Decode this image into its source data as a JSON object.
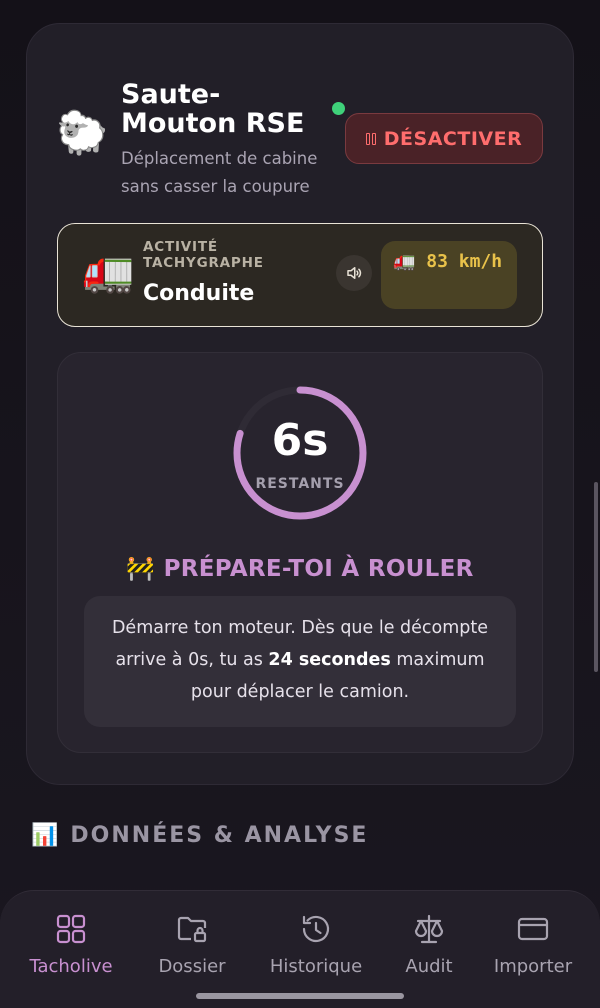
{
  "mode": {
    "emoji": "🐑",
    "title": "Saute-Mouton RSE",
    "subtitle": "Déplacement de cabine sans casser la coupure",
    "status_color": "#3fd17a",
    "deactivate_label": "DÉSACTIVER"
  },
  "activity": {
    "emoji": "🚛",
    "label": "ACTIVITÉ TACHYGRAPHE",
    "value": "Conduite",
    "speed": "🚛 83 km/h"
  },
  "countdown": {
    "value": "6s",
    "label": "RESTANTS",
    "progress": 0.8,
    "accent": "#c890d0"
  },
  "prepare": {
    "title": "🚧 PRÉPARE-TOI À ROULER",
    "text_before": "Démarre ton moteur. Dès que le décompte arrive à 0s, tu as ",
    "text_bold": "24 secondes",
    "text_after": " maximum pour déplacer le camion."
  },
  "section": {
    "emoji": "📊",
    "title": "DONNÉES & ANALYSE"
  },
  "nav": {
    "items": [
      {
        "label": "Tacholive",
        "icon": "grid-icon",
        "active": true
      },
      {
        "label": "Dossier",
        "icon": "folder-lock-icon",
        "active": false
      },
      {
        "label": "Historique",
        "icon": "history-icon",
        "active": false
      },
      {
        "label": "Audit",
        "icon": "scale-icon",
        "active": false
      },
      {
        "label": "Importer",
        "icon": "card-icon",
        "active": false
      }
    ]
  }
}
